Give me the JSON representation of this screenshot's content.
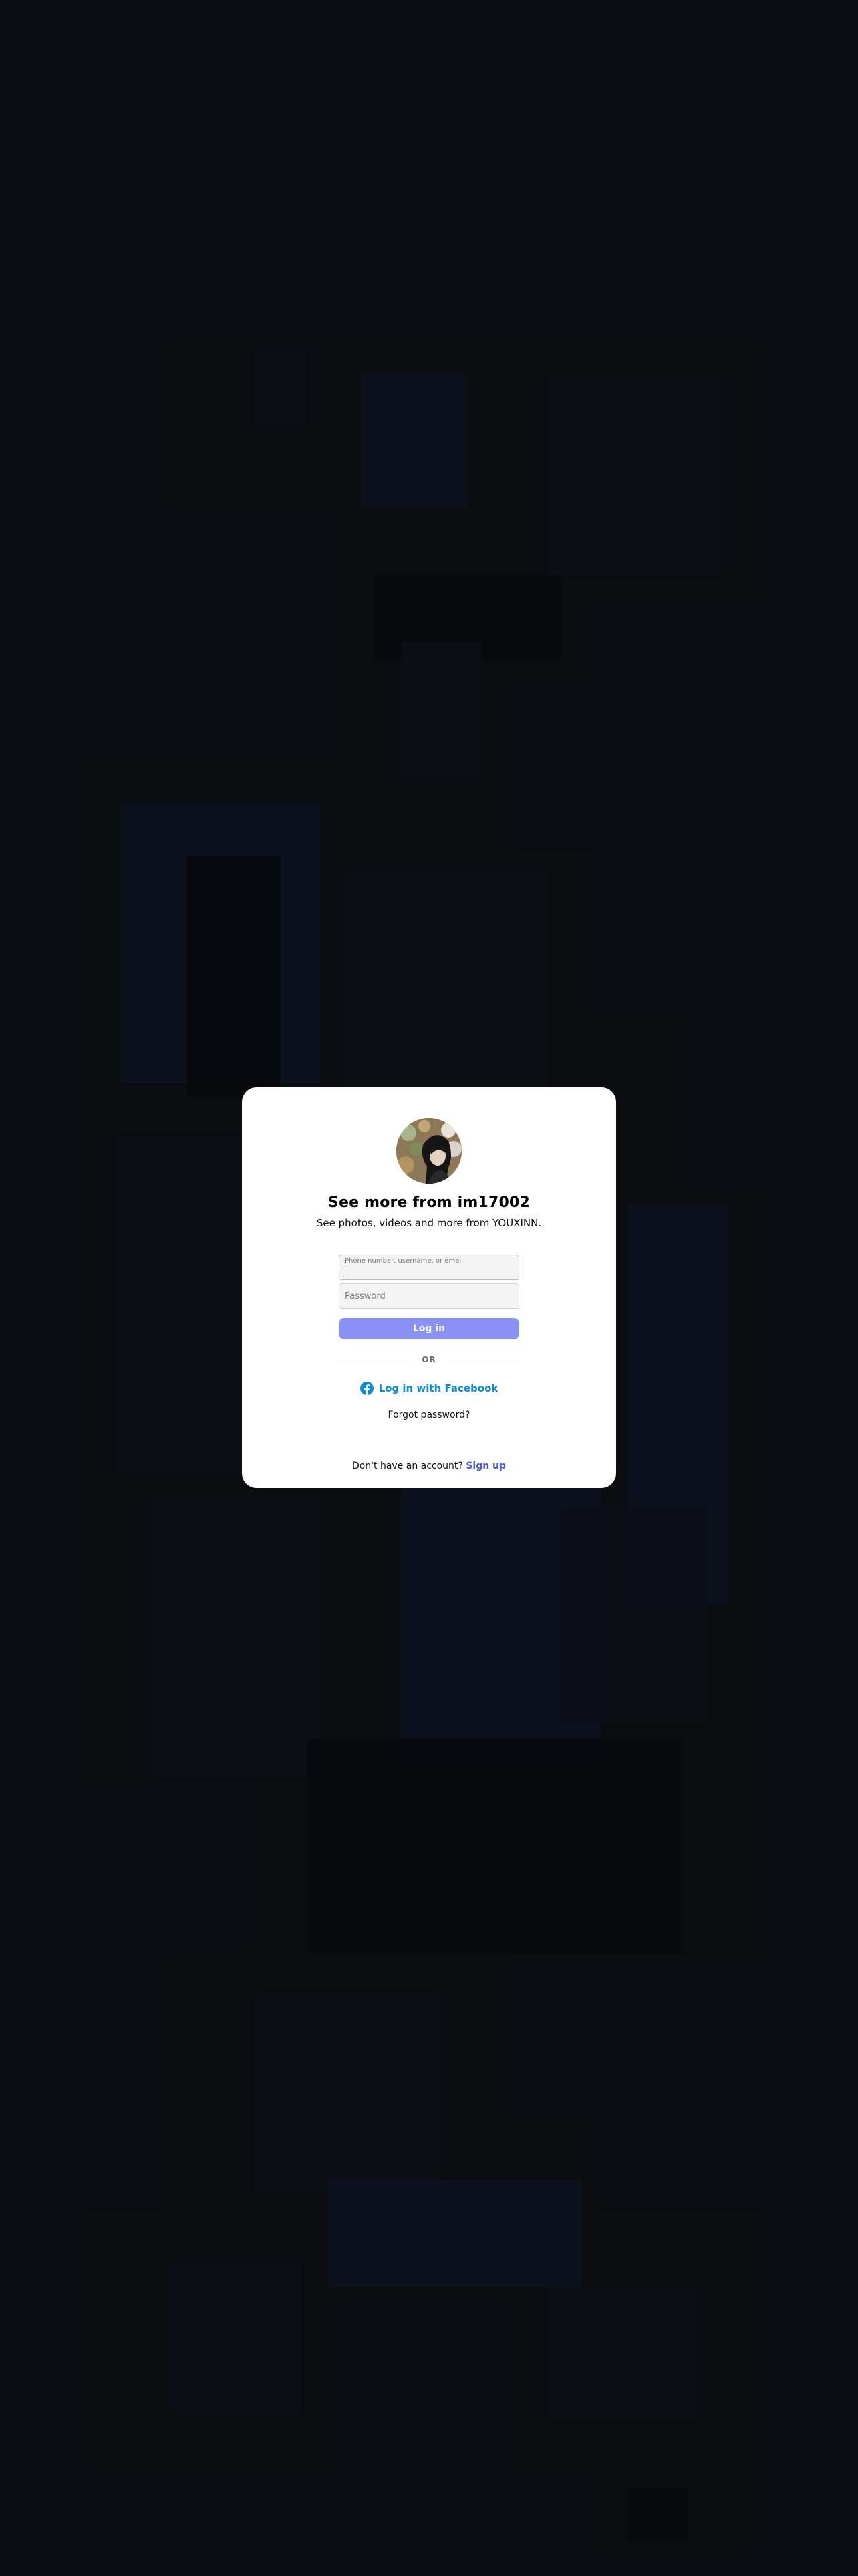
{
  "modal": {
    "title": "See more from im17002",
    "subtitle": "See photos, videos and more from YOUXINN.",
    "username_label": "Phone number, username, or email",
    "password_placeholder": "Password",
    "login_label": "Log in",
    "or_label": "OR",
    "facebook_label": "Log in with Facebook",
    "forgot_label": "Forgot password?",
    "no_account_text": "Don't have an account?",
    "signup_label": "Sign up"
  },
  "colors": {
    "background": "#0b0e12",
    "login_button": "#8a93f3",
    "facebook_link": "#0a8cd2",
    "signup_link": "#4a5ad8"
  },
  "icons": {
    "facebook": "facebook-circle-icon",
    "avatar": "profile-photo"
  }
}
